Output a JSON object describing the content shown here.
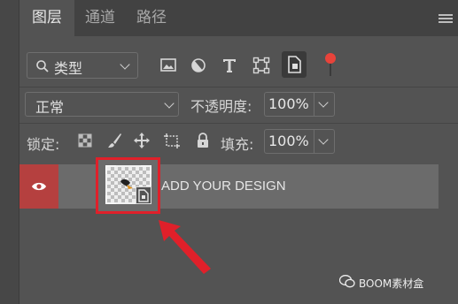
{
  "tabs": [
    {
      "label": "图层",
      "active": true
    },
    {
      "label": "通道",
      "active": false
    },
    {
      "label": "路径",
      "active": false
    }
  ],
  "filter": {
    "kind_label": "类型",
    "icons": [
      "image-filter-icon",
      "adjustment-filter-icon",
      "type-filter-icon",
      "shape-filter-icon",
      "smart-object-filter-icon"
    ],
    "toggle_color": "#e8433a"
  },
  "blend": {
    "mode": "正常",
    "opacity_label": "不透明度:",
    "opacity_value": "100%"
  },
  "lock": {
    "label": "锁定:",
    "fill_label": "填充:",
    "fill_value": "100%"
  },
  "layer": {
    "name": "ADD YOUR DESIGN",
    "visible": true,
    "highlight_color": "#e0202a"
  },
  "watermark": "BOOM素材盒"
}
